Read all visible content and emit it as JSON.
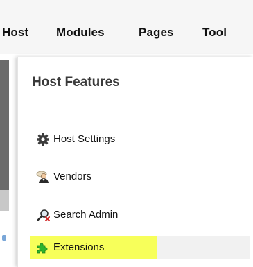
{
  "menu": {
    "items": [
      {
        "label": "Host"
      },
      {
        "label": "Modules"
      },
      {
        "label": "Pages"
      },
      {
        "label": "Tool"
      }
    ]
  },
  "panel": {
    "title": "Host Features",
    "features": [
      {
        "label": "Host Settings",
        "icon": "gear-icon"
      },
      {
        "label": "Vendors",
        "icon": "vendor-person-icon"
      },
      {
        "label": "Search Admin",
        "icon": "magnifier-icon"
      },
      {
        "label": "Extensions",
        "icon": "puzzle-icon",
        "highlighted": true
      }
    ]
  },
  "colors": {
    "highlight": "#f7ff5a",
    "puzzle": "#2db52d"
  }
}
